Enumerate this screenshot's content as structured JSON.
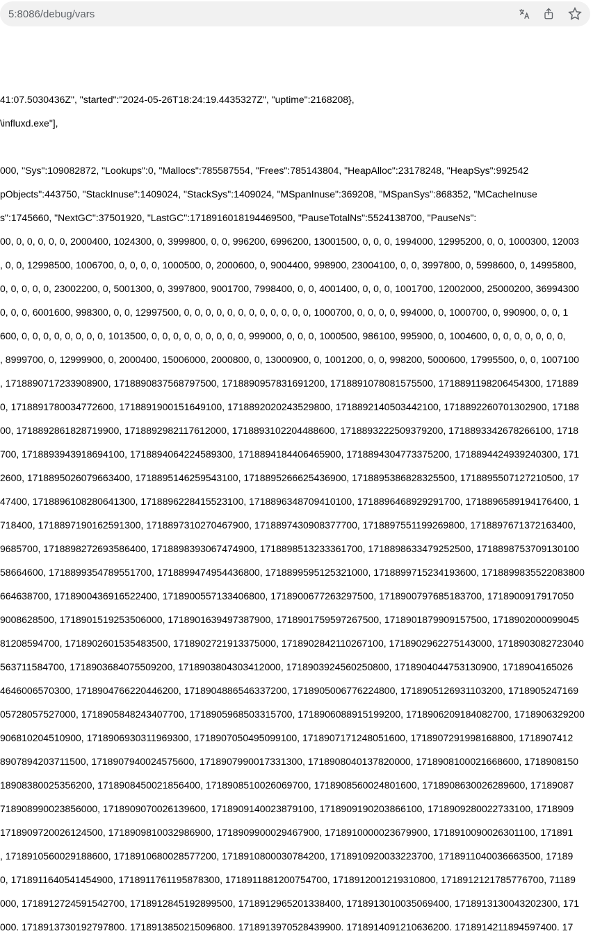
{
  "url_bar": {
    "url": "5:8086/debug/vars"
  },
  "content": {
    "line1": "41:07.5030436Z\", \"started\":\"2024-05-26T18:24:19.4435327Z\", \"uptime\":2168208},",
    "line2": "\\influxd.exe\"],",
    "line3": "000, \"Sys\":109082872, \"Lookups\":0, \"Mallocs\":785587554, \"Frees\":785143804, \"HeapAlloc\":23178248, \"HeapSys\":992542",
    "line4": "pObjects\":443750, \"StackInuse\":1409024, \"StackSys\":1409024, \"MSpanInuse\":369208, \"MSpanSys\":868352, \"MCacheInuse",
    "line5": "s\":1745660, \"NextGC\":37501920, \"LastGC\":1718916018194469500, \"PauseTotalNs\":5524138700, \"PauseNs\":",
    "line6": "00, 0, 0, 0, 0, 0, 2000400, 1024300, 0, 3999800, 0, 0, 996200, 6996200, 13001500, 0, 0, 0, 1994000, 12995200, 0, 0, 1000300, 12003",
    "line7": ", 0, 0, 12998500, 1006700, 0, 0, 0, 0, 1000500, 0, 2000600, 0, 9004400, 998900, 23004100, 0, 0, 3997800, 0, 5998600, 0, 14995800,",
    "line8": "0, 0, 0, 0, 0, 23002200, 0, 5001300, 0, 3997800, 9001700, 7998400, 0, 0, 4001400, 0, 0, 0, 1001700, 12002000, 25000200, 36994300",
    "line9": "0, 0, 0, 6001600, 998300, 0, 0, 12997500, 0, 0, 0, 0, 0, 0, 0, 0, 0, 0, 0, 0, 1000700, 0, 0, 0, 0, 994000, 0, 1000700, 0, 990900, 0, 0, 1",
    "line10": "600, 0, 0, 0, 0, 0, 0, 0, 0, 1013500, 0, 0, 0, 0, 0, 0, 0, 0, 0, 999000, 0, 0, 0, 1000500, 986100, 995900, 0, 1004600, 0, 0, 0, 0, 0, 0, 0,",
    "line11": ", 8999700, 0, 12999900, 0, 2000400, 15006000, 2000800, 0, 13000900, 0, 1001200, 0, 0, 998200, 5000600, 17995500, 0, 0, 1007100",
    "line12": ", 1718890717233908900, 1718890837568797500, 1718890957831691200, 1718891078081575500, 1718891198206454300, 171889",
    "line13": "0, 1718891780034772600, 1718891900151649100, 1718892020243529800, 1718892140503442100, 1718892260701302900, 17188",
    "line14": "00, 1718892861828719900, 1718892982117612000, 1718893102204488600, 1718893222509379200, 1718893342678266100, 1718",
    "line15": "700, 1718893943918694100, 1718894064224589300, 1718894184406465900, 1718894304773375200, 1718894424939240300, 171",
    "line16": "2600, 1718895026079663400, 1718895146259543100, 1718895266625436900, 1718895386828325500, 1718895507127210500, 17",
    "line17": "47400, 1718896108280641300, 1718896228415523100, 1718896348709410100, 1718896468929291700, 1718896589194176400, 1",
    "line18": "718400, 1718897190162591300, 1718897310270467900, 1718897430908377700, 1718897551199269800, 1718897671372163400,",
    "line19": "9685700, 1718898272693586400, 1718898393067474900, 1718898513233361700, 1718898633479252500, 1718898753709130100",
    "line20": "58664600, 1718899354789551700, 1718899474954436800, 1718899595125321000, 1718899715234193600, 1718899835522083800",
    "line21": "664638700, 1718900436916522400, 1718900557133406800, 1718900677263297500, 1718900797685183700, 1718900917917050",
    "line22": "9008628500, 1718901519253506000, 1718901639497387900, 1718901759597267500, 1718901879909157500, 1718902000099045",
    "line23": "81208594700, 1718902601535483500, 1718902721913375000, 1718902842110267100, 1718902962275143000, 1718903082723040",
    "line24": "563711584700, 1718903684075509200, 1718903804303412000, 1718903924560250800, 1718904044753130900, 1718904165026",
    "line25": "4646006570300, 1718904766220446200, 1718904886546337200, 1718905006776224800, 1718905126931103200, 1718905247169",
    "line26": "05728057527000, 1718905848243407700, 1718905968503315700, 1718906088915199200, 1718906209184082700, 1718906329200",
    "line27": "906810204510900, 1718906930311969300, 1718907050495099100, 1718907171248051600, 1718907291998168800, 1718907412",
    "line28": "8907894203711500, 1718907940024575600, 1718907990017331300, 1718908040137820000, 1718908100021668600, 1718908150",
    "line29": "18908380025356200, 1718908450021856400, 1718908510026069700, 1718908560024801600, 1718908630026289600, 17189087",
    "line30": "718908990023856000, 1718909070026139600, 1718909140023879100, 1718909190203866100, 1718909280022733100, 1718909",
    "line31": "1718909720026124500, 1718909810032986900, 1718909900029467900, 1718910000023679900, 1718910090026301100, 171891",
    "line32": ", 1718910560029188600, 1718910680028577200, 1718910800030784200, 1718910920033223700, 1718911040036663500, 17189",
    "line33": "0, 1718911640541454900, 1718911761195878300, 1718911881200754700, 1718912001219310800, 1718912121785776700, 71189",
    "line34": "000, 1718912724591542700, 1718912845192899500, 1718912965201338400, 1718913010035069400, 1718913130043202300, 171",
    "line35": "000. 1718913730192797800. 1718913850215096800. 1718913970528439900. 1718914091210636200. 1718914211894597400. 17"
  }
}
